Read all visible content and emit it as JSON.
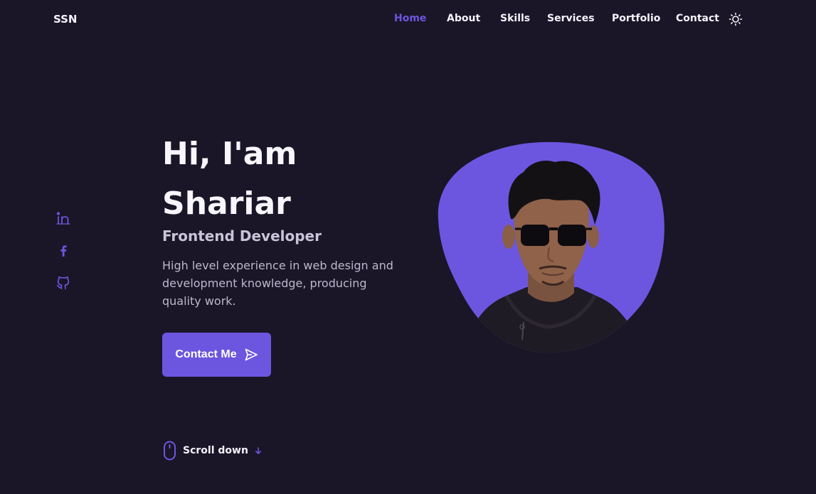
{
  "header": {
    "logo": "SSN",
    "nav": [
      {
        "label": "Home",
        "active": true
      },
      {
        "label": "About",
        "active": false
      },
      {
        "label": "Skills",
        "active": false
      },
      {
        "label": "Services",
        "active": false
      },
      {
        "label": "Portfolio",
        "active": false
      },
      {
        "label": "Contact",
        "active": false
      }
    ],
    "theme_icon": "sun-icon"
  },
  "social": [
    {
      "icon": "linkedin-icon"
    },
    {
      "icon": "facebook-icon"
    },
    {
      "icon": "github-icon"
    }
  ],
  "hero": {
    "greeting": "Hi, I'am",
    "name": "Shariar",
    "subtitle": "Frontend Developer",
    "description": "High level experience in web design and development knowledge, producing quality work.",
    "cta_label": "Contact Me",
    "cta_icon": "send-icon"
  },
  "scroll": {
    "label": "Scroll down",
    "mouse_icon": "mouse-icon",
    "arrow_icon": "arrow-down-icon"
  },
  "colors": {
    "background": "#1a1627",
    "accent": "#6c56e0",
    "title": "#f7f6fc",
    "text": "#bcb8cc"
  }
}
